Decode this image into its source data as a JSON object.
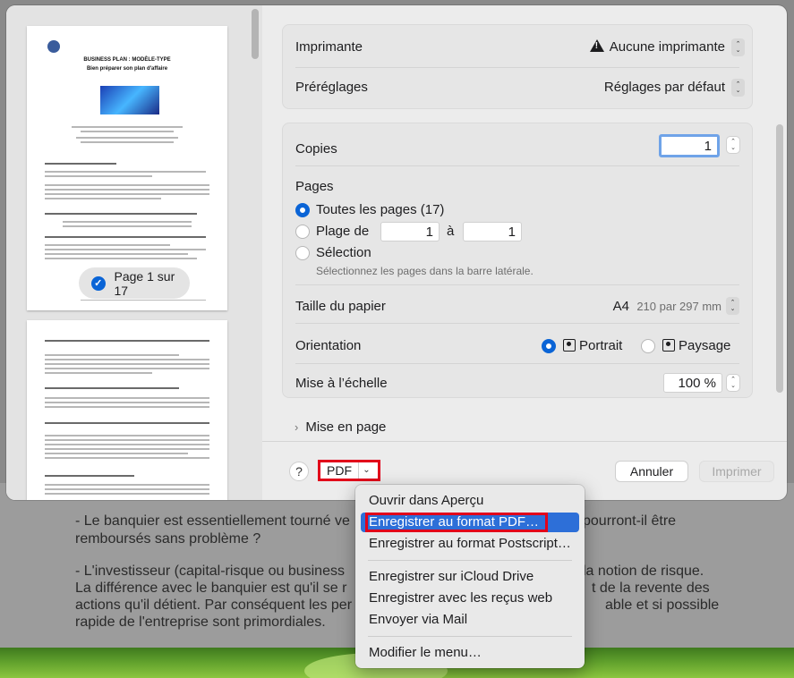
{
  "background": {
    "lines": [
      "- Le banquier est essentiellement tourné ve",
      "pourront-il être",
      "remboursés sans problème ?",
      "- L'investisseur (capital-risque ou business",
      "la notion de risque.",
      "La différence avec le banquier est qu'il se r",
      "t de la revente des",
      "actions qu'il détient. Par conséquent les per",
      "able et si possible",
      "rapide de l'entreprise sont primordiales."
    ]
  },
  "preview": {
    "doc_title_1": "BUSINESS PLAN : MODÈLE-TYPE",
    "doc_title_2": "Bien préparer son plan d'affaire",
    "page_indicator": "Page 1 sur 17"
  },
  "settings": {
    "printer_label": "Imprimante",
    "printer_value": "Aucune imprimante",
    "presets_label": "Préréglages",
    "presets_value": "Réglages par défaut",
    "copies_label": "Copies",
    "copies_value": "1",
    "pages_label": "Pages",
    "pages_all": "Toutes les pages (17)",
    "pages_range": "Plage de",
    "range_from": "1",
    "range_to_label": "à",
    "range_to": "1",
    "pages_selection": "Sélection",
    "selection_hint": "Sélectionnez les pages dans la barre latérale.",
    "paper_label": "Taille du papier",
    "paper_value": "A4",
    "paper_dims": "210 par 297 mm",
    "orientation_label": "Orientation",
    "portrait": "Portrait",
    "landscape": "Paysage",
    "scale_label": "Mise à l’échelle",
    "scale_value": "100 %",
    "layout_label": "Mise en page"
  },
  "footer": {
    "help": "?",
    "pdf": "PDF",
    "cancel": "Annuler",
    "print": "Imprimer"
  },
  "menu": {
    "items": [
      "Ouvrir dans Aperçu",
      "Enregistrer au format PDF…",
      "Enregistrer au format Postscript…",
      "Enregistrer sur iCloud Drive",
      "Enregistrer avec les reçus web",
      "Envoyer via Mail",
      "Modifier le menu…"
    ]
  }
}
